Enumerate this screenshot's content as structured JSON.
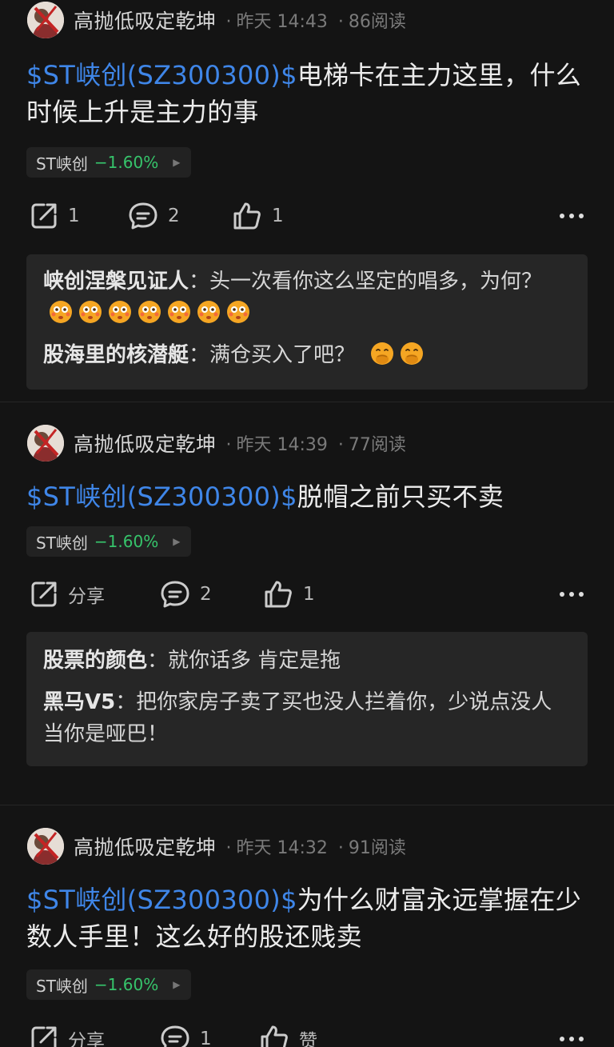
{
  "posts": [
    {
      "author": "高抛低吸定乾坤",
      "time": "昨天 14:43",
      "reads": "86阅读",
      "tag": "$ST峡创(SZ300300)$",
      "text": "电梯卡在主力这里，什么时候上升是主力的事",
      "stock": {
        "name": "ST峡创",
        "change": "−1.60%"
      },
      "actions": {
        "share": "1",
        "comment": "2",
        "like": "1"
      },
      "comments": [
        {
          "user": "峡创涅槃见证人",
          "sep": "：",
          "text": "头一次看你这么坚定的唱多，为何？",
          "emojis": [
            "flushed-face",
            "flushed-face",
            "flushed-face",
            "flushed-face",
            "flushed-face",
            "flushed-face",
            "flushed-face"
          ]
        },
        {
          "user": "股海里的核潜艇",
          "sep": "：",
          "text": "满仓买入了吧？",
          "emojis": [
            "hand-over-mouth-face",
            "hand-over-mouth-face"
          ]
        }
      ]
    },
    {
      "author": "高抛低吸定乾坤",
      "time": "昨天 14:39",
      "reads": "77阅读",
      "tag": "$ST峡创(SZ300300)$",
      "text": "脱帽之前只买不卖",
      "stock": {
        "name": "ST峡创",
        "change": "−1.60%"
      },
      "actions": {
        "share": "分享",
        "comment": "2",
        "like": "1"
      },
      "comments": [
        {
          "user": "股票的颜色",
          "sep": "：",
          "text": "就你话多 肯定是拖",
          "emojis": []
        },
        {
          "user": "黑马V5",
          "sep": "：",
          "text": "把你家房子卖了买也没人拦着你，少说点没人当你是哑巴！",
          "emojis": []
        }
      ]
    },
    {
      "author": "高抛低吸定乾坤",
      "time": "昨天 14:32",
      "reads": "91阅读",
      "tag": "$ST峡创(SZ300300)$",
      "text": "为什么财富永远掌握在少数人手里！这么好的股还贱卖",
      "stock": {
        "name": "ST峡创",
        "change": "−1.60%"
      },
      "actions": {
        "share": "分享",
        "comment": "1",
        "like": "赞"
      },
      "comments": []
    }
  ],
  "colors": {
    "tag": "#3f86e8",
    "change_down": "#36c46b",
    "background": "#141414",
    "comment_box": "#262626"
  },
  "icons": {
    "share": "share-icon",
    "comment": "comment-icon",
    "like": "thumbs-up-icon",
    "more": "more-dots-icon"
  }
}
